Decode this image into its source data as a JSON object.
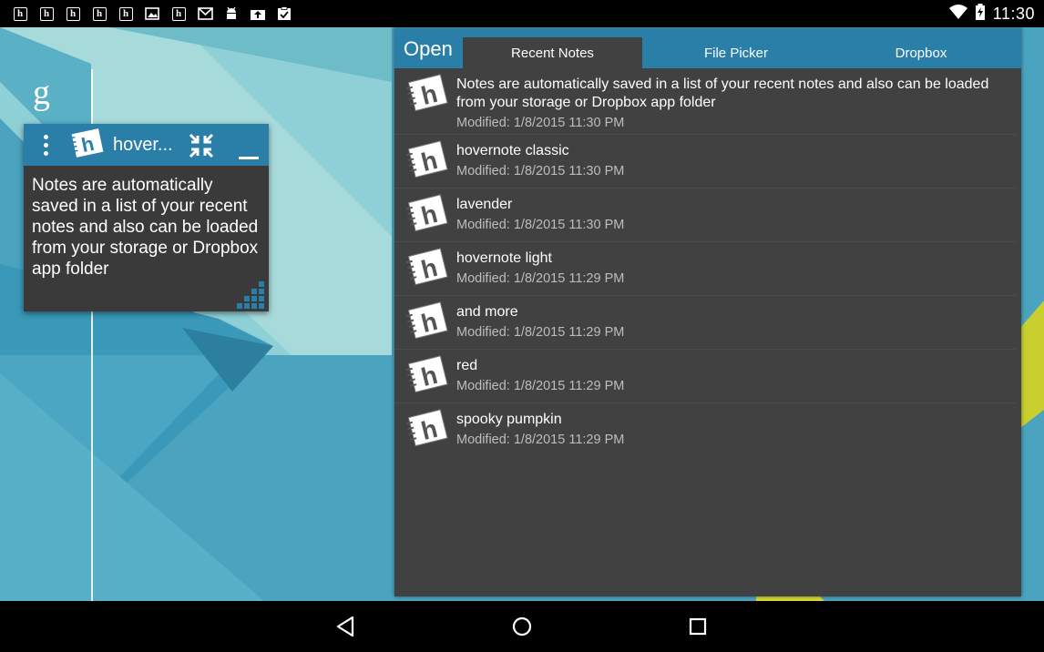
{
  "status_bar": {
    "notification_icons": [
      "hovernote-icon",
      "hovernote-icon",
      "hovernote-icon",
      "hovernote-icon",
      "hovernote-icon",
      "image-icon",
      "hovernote-icon",
      "email-icon",
      "android-icon",
      "upload-icon",
      "clipboard-check-icon"
    ],
    "time": "11:30"
  },
  "wallpaper": {
    "search_letter": "g",
    "colors": {
      "base": "#4aa3bf",
      "light": "#9cd3d6",
      "dark": "#2e7f9e",
      "accent": "#d6d633"
    }
  },
  "widget": {
    "title": "hover...",
    "body": "Notes are automatically saved in a list of your recent notes and also can be loaded from your storage or Dropbox app folder"
  },
  "panel": {
    "title": "Open",
    "tabs": [
      {
        "label": "Recent Notes"
      },
      {
        "label": "File Picker"
      },
      {
        "label": "Dropbox"
      }
    ],
    "notes": [
      {
        "name": "Notes are automatically saved in a list of your recent notes and also can be loaded from your storage or Dropbox app folder",
        "modified": "Modified: 1/8/2015 11:30 PM"
      },
      {
        "name": "hovernote classic",
        "modified": "Modified: 1/8/2015 11:30 PM"
      },
      {
        "name": "lavender",
        "modified": "Modified: 1/8/2015 11:30 PM"
      },
      {
        "name": "hovernote light",
        "modified": "Modified: 1/8/2015 11:29 PM"
      },
      {
        "name": "and more",
        "modified": "Modified: 1/8/2015 11:29 PM"
      },
      {
        "name": "red",
        "modified": "Modified: 1/8/2015 11:29 PM"
      },
      {
        "name": "spooky pumpkin",
        "modified": "Modified: 1/8/2015 11:29 PM"
      }
    ]
  },
  "theme": {
    "accent": "#2a7fa9",
    "panel_bg": "#414141",
    "widget_bg": "#3a3a3a"
  }
}
